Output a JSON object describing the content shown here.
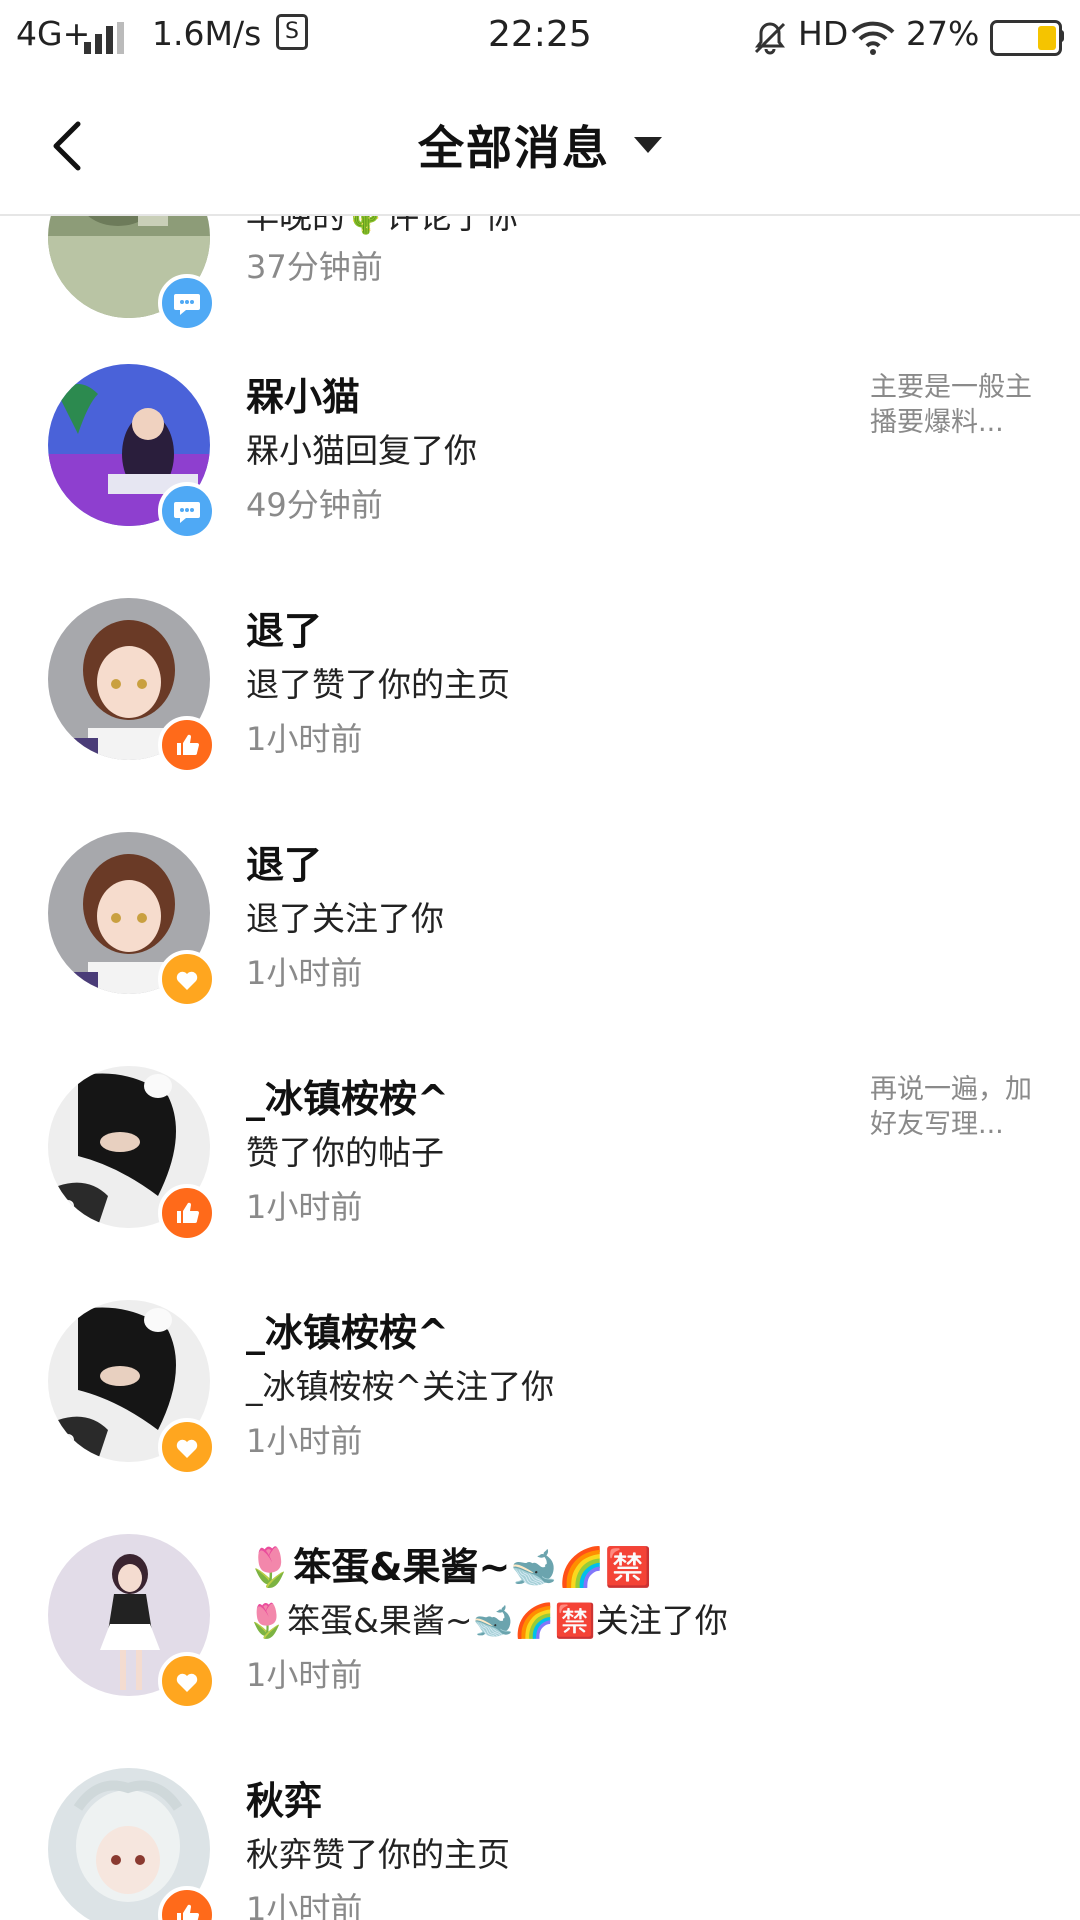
{
  "status_bar": {
    "network": "4G+",
    "speed": "1.6M/s",
    "s_icon": "S",
    "time": "22:25",
    "hd": "HD",
    "battery": "27%"
  },
  "header": {
    "title": "全部消息"
  },
  "notifications": [
    {
      "name": "",
      "action": "早晚的🌵评论了你",
      "time": "37分钟前",
      "badge": "comment-icon",
      "preview": ""
    },
    {
      "name": "槑小猫",
      "action": "槑小猫回复了你",
      "time": "49分钟前",
      "badge": "comment-icon",
      "preview": "主要是一般主播要爆料..."
    },
    {
      "name": "退了",
      "action": "退了赞了你的主页",
      "time": "1小时前",
      "badge": "thumbs-up-icon",
      "preview": ""
    },
    {
      "name": "退了",
      "action": "退了关注了你",
      "time": "1小时前",
      "badge": "heart-icon",
      "preview": ""
    },
    {
      "name": "_冰镇桉桉^",
      "action": "赞了你的帖子",
      "time": "1小时前",
      "badge": "thumbs-up-icon",
      "preview": "再说一遍，加好友写理..."
    },
    {
      "name": "_冰镇桉桉^",
      "action": "_冰镇桉桉^关注了你",
      "time": "1小时前",
      "badge": "heart-icon",
      "preview": ""
    },
    {
      "name": "🌷笨蛋&果酱~🐋🌈🈲",
      "action": "🌷笨蛋&果酱~🐋🌈🈲关注了你",
      "time": "1小时前",
      "badge": "heart-icon",
      "preview": ""
    },
    {
      "name": "秋弈",
      "action": "秋弈赞了你的主页",
      "time": "1小时前",
      "badge": "thumbs-up-icon",
      "preview": ""
    }
  ],
  "colors": {
    "comment_badge": "#4fa9f5",
    "like_badge": "#ff6a1a",
    "follow_badge": "#ffa61f",
    "secondary_text": "#8a8a8a",
    "battery_fill": "#f5c400"
  }
}
